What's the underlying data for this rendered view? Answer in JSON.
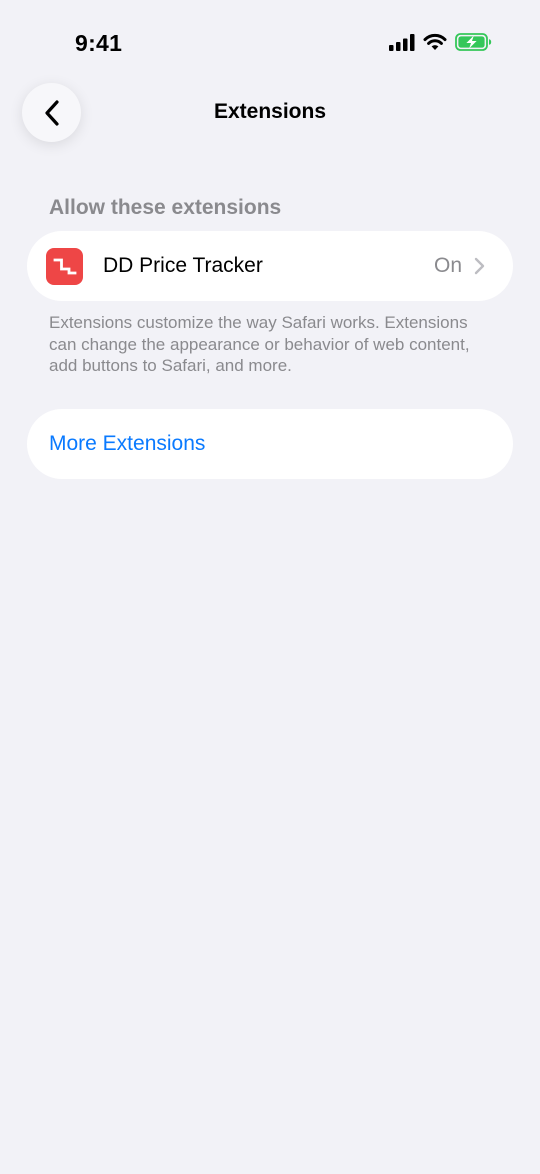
{
  "status_bar": {
    "time": "9:41"
  },
  "nav": {
    "back_icon": "chevron-left-icon",
    "title": "Extensions"
  },
  "extensions_section": {
    "header": "Allow these extensions",
    "items": [
      {
        "icon": "price-tracker-icon",
        "icon_color": "#EE4646",
        "name": "DD Price Tracker",
        "value": "On"
      }
    ],
    "footer": "Extensions customize the way Safari works. Extensions can change the appearance or behavior of web content, add buttons to Safari, and more."
  },
  "more": {
    "label": "More Extensions",
    "color": "#0A7AFF"
  },
  "colors": {
    "background": "#F2F2F7",
    "secondary_text": "#8A8A8E",
    "battery_charging": "#34C759"
  }
}
